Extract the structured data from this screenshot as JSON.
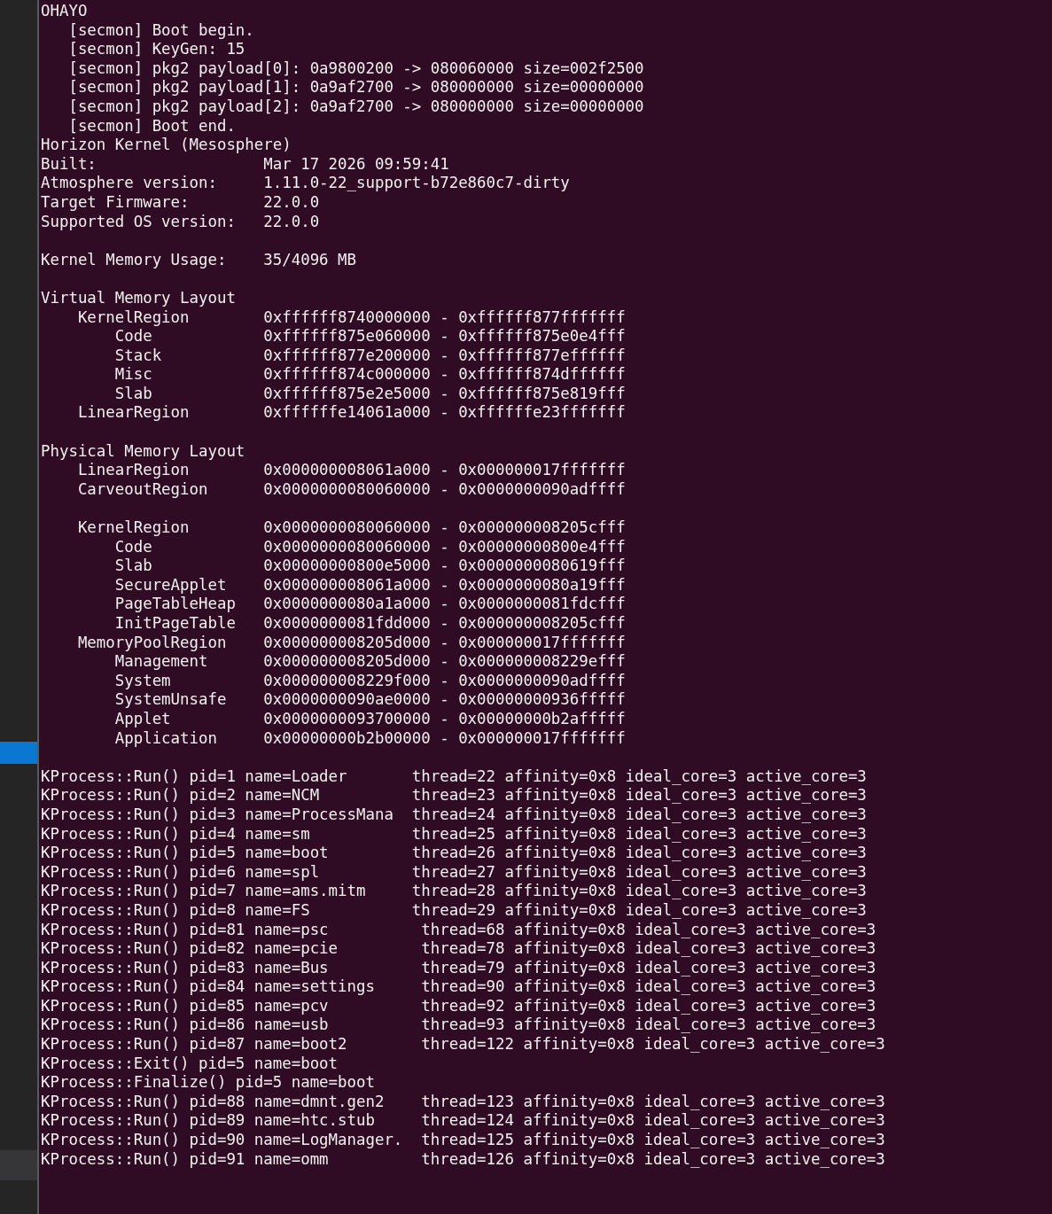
{
  "terminal": {
    "blocks": [
      {
        "lines": [
          "OHAYO",
          "   [secmon] Boot begin.",
          "   [secmon] KeyGen: 15",
          "   [secmon] pkg2 payload[0]: 0a9800200 -> 080060000 size=002f2500",
          "   [secmon] pkg2 payload[1]: 0a9af2700 -> 080000000 size=00000000",
          "   [secmon] pkg2 payload[2]: 0a9af2700 -> 080000000 size=00000000",
          "   [secmon] Boot end.",
          "Horizon Kernel (Mesosphere)",
          "Built:                  Mar 17 2026 09:59:41",
          "Atmosphere version:     1.11.0-22_support-b72e860c7-dirty",
          "Target Firmware:        22.0.0",
          "Supported OS version:   22.0.0"
        ]
      },
      {
        "lines": [
          "Kernel Memory Usage:    35/4096 MB"
        ]
      },
      {
        "lines": [
          "Virtual Memory Layout",
          "    KernelRegion        0xffffff8740000000 - 0xffffff877fffffff",
          "        Code            0xffffff875e060000 - 0xffffff875e0e4fff",
          "        Stack           0xffffff877e200000 - 0xffffff877effffff",
          "        Misc            0xffffff874c000000 - 0xffffff874dffffff",
          "        Slab            0xffffff875e2e5000 - 0xffffff875e819fff",
          "    LinearRegion        0xffffffe14061a000 - 0xffffffe23fffffff"
        ]
      },
      {
        "lines": [
          "Physical Memory Layout",
          "    LinearRegion        0x000000008061a000 - 0x000000017fffffff",
          "    CarveoutRegion      0x0000000080060000 - 0x0000000090adffff"
        ]
      },
      {
        "lines": [
          "    KernelRegion        0x0000000080060000 - 0x000000008205cfff",
          "        Code            0x0000000080060000 - 0x00000000800e4fff",
          "        Slab            0x00000000800e5000 - 0x0000000080619fff",
          "        SecureApplet    0x000000008061a000 - 0x0000000080a19fff",
          "        PageTableHeap   0x0000000080a1a000 - 0x0000000081fdcfff",
          "        InitPageTable   0x0000000081fdd000 - 0x000000008205cfff",
          "    MemoryPoolRegion    0x000000008205d000 - 0x000000017fffffff",
          "        Management      0x000000008205d000 - 0x000000008229efff",
          "        System          0x000000008229f000 - 0x0000000090adffff",
          "        SystemUnsafe    0x0000000090ae0000 - 0x00000000936fffff",
          "        Applet          0x0000000093700000 - 0x00000000b2afffff",
          "        Application     0x00000000b2b00000 - 0x000000017fffffff"
        ]
      },
      {
        "lines": [
          "KProcess::Run() pid=1 name=Loader       thread=22 affinity=0x8 ideal_core=3 active_core=3",
          "KProcess::Run() pid=2 name=NCM          thread=23 affinity=0x8 ideal_core=3 active_core=3",
          "KProcess::Run() pid=3 name=ProcessMana  thread=24 affinity=0x8 ideal_core=3 active_core=3",
          "KProcess::Run() pid=4 name=sm           thread=25 affinity=0x8 ideal_core=3 active_core=3",
          "KProcess::Run() pid=5 name=boot         thread=26 affinity=0x8 ideal_core=3 active_core=3",
          "KProcess::Run() pid=6 name=spl          thread=27 affinity=0x8 ideal_core=3 active_core=3",
          "KProcess::Run() pid=7 name=ams.mitm     thread=28 affinity=0x8 ideal_core=3 active_core=3",
          "KProcess::Run() pid=8 name=FS           thread=29 affinity=0x8 ideal_core=3 active_core=3",
          "KProcess::Run() pid=81 name=psc          thread=68 affinity=0x8 ideal_core=3 active_core=3",
          "KProcess::Run() pid=82 name=pcie         thread=78 affinity=0x8 ideal_core=3 active_core=3",
          "KProcess::Run() pid=83 name=Bus          thread=79 affinity=0x8 ideal_core=3 active_core=3",
          "KProcess::Run() pid=84 name=settings     thread=90 affinity=0x8 ideal_core=3 active_core=3",
          "KProcess::Run() pid=85 name=pcv          thread=92 affinity=0x8 ideal_core=3 active_core=3",
          "KProcess::Run() pid=86 name=usb          thread=93 affinity=0x8 ideal_core=3 active_core=3",
          "KProcess::Run() pid=87 name=boot2        thread=122 affinity=0x8 ideal_core=3 active_core=3",
          "KProcess::Exit() pid=5 name=boot",
          "KProcess::Finalize() pid=5 name=boot",
          "KProcess::Run() pid=88 name=dmnt.gen2    thread=123 affinity=0x8 ideal_core=3 active_core=3",
          "KProcess::Run() pid=89 name=htc.stub     thread=124 affinity=0x8 ideal_core=3 active_core=3",
          "KProcess::Run() pid=90 name=LogManager.  thread=125 affinity=0x8 ideal_core=3 active_core=3",
          "KProcess::Run() pid=91 name=omm          thread=126 affinity=0x8 ideal_core=3 active_core=3"
        ]
      }
    ]
  }
}
